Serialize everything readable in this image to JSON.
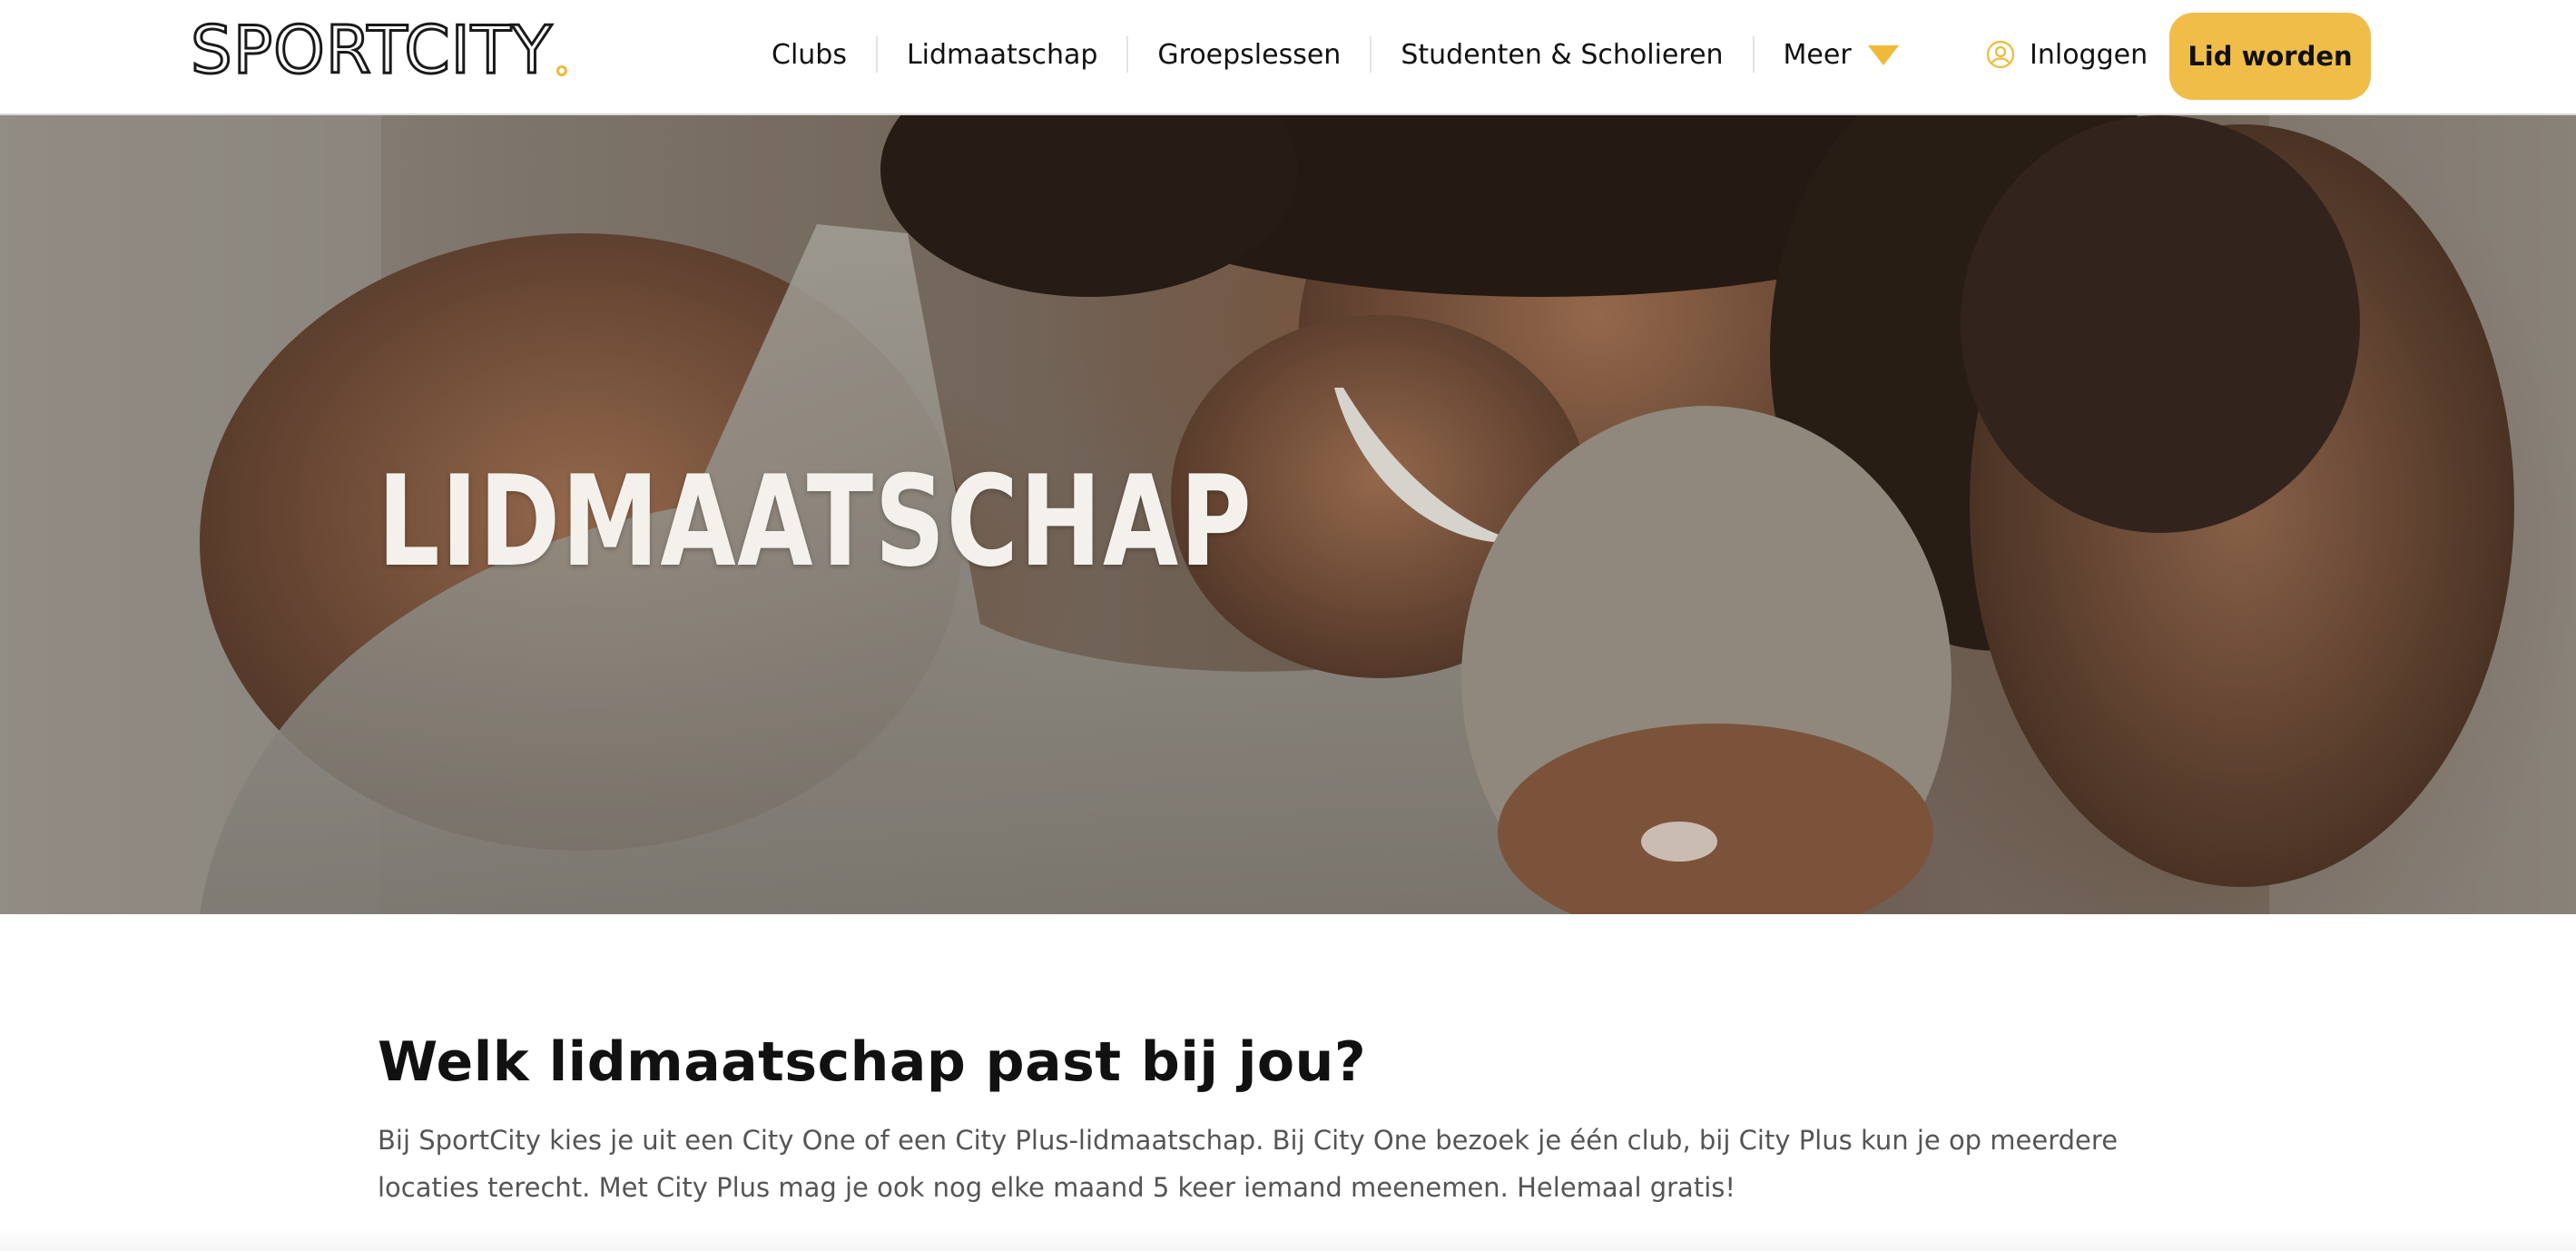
{
  "header": {
    "logo_text": "SPORTCITY",
    "logo_accent_color": "#f0b93a",
    "nav": [
      {
        "label": "Clubs"
      },
      {
        "label": "Lidmaatschap"
      },
      {
        "label": "Groepslessen"
      },
      {
        "label": "Studenten & Scholieren"
      },
      {
        "label": "Meer",
        "icon": "chevron-down-icon"
      }
    ],
    "login_label": "Inloggen",
    "login_icon": "user-circle-icon",
    "cta_label": "Lid worden",
    "cta_color": "#f0bd48"
  },
  "hero": {
    "title": "LIDMAATSCHAP",
    "image": "two smiling women embracing"
  },
  "main": {
    "heading": "Welk lidmaatschap past bij jou?",
    "intro": "Bij SportCity kies je uit een City One of een City Plus-lidmaatschap. Bij City One bezoek je één club, bij City Plus kun je op meerdere locaties terecht. Met City Plus mag je ook nog elke maand 5 keer iemand meenemen. Helemaal gratis!"
  }
}
